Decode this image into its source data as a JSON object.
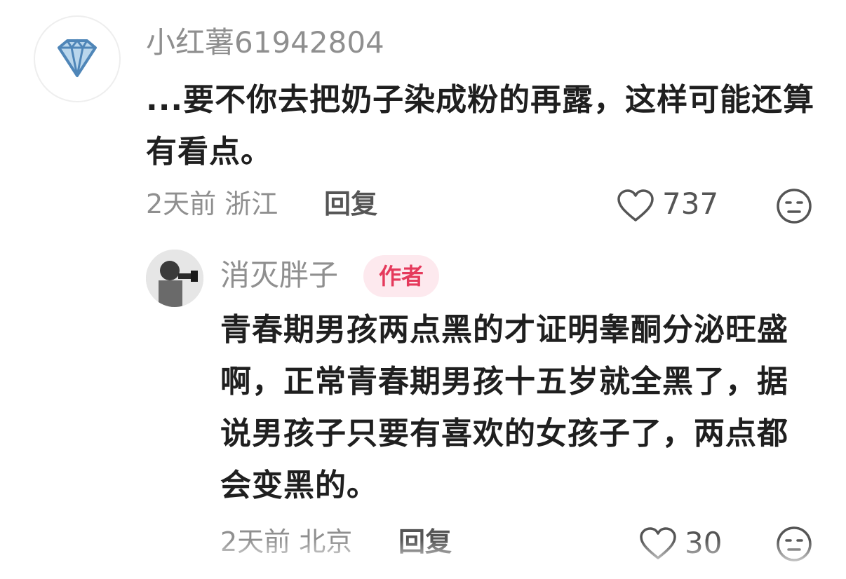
{
  "comments": [
    {
      "username": "小红薯61942804",
      "avatar_icon": "diamond-icon",
      "text": "...要不你去把奶子染成粉的再露，这样可能还算有看点。",
      "time_location": "2天前 浙江",
      "reply_label": "回复",
      "likes": "737"
    },
    {
      "username": "消灭胖子",
      "badge": "作者",
      "avatar_icon": "user-photo",
      "text": "青春期男孩两点黑的才证明睾酮分泌旺盛啊，正常青春期男孩十五岁就全黑了，据说男孩子只要有喜欢的女孩子了，两点都会变黑的。",
      "time_location": "2天前 北京",
      "reply_label": "回复",
      "likes": "30"
    }
  ],
  "colors": {
    "badge_bg": "#fde9ee",
    "badge_text": "#e53a5c",
    "meta": "#8f8f8f",
    "diamond": "#7aa8cf"
  }
}
